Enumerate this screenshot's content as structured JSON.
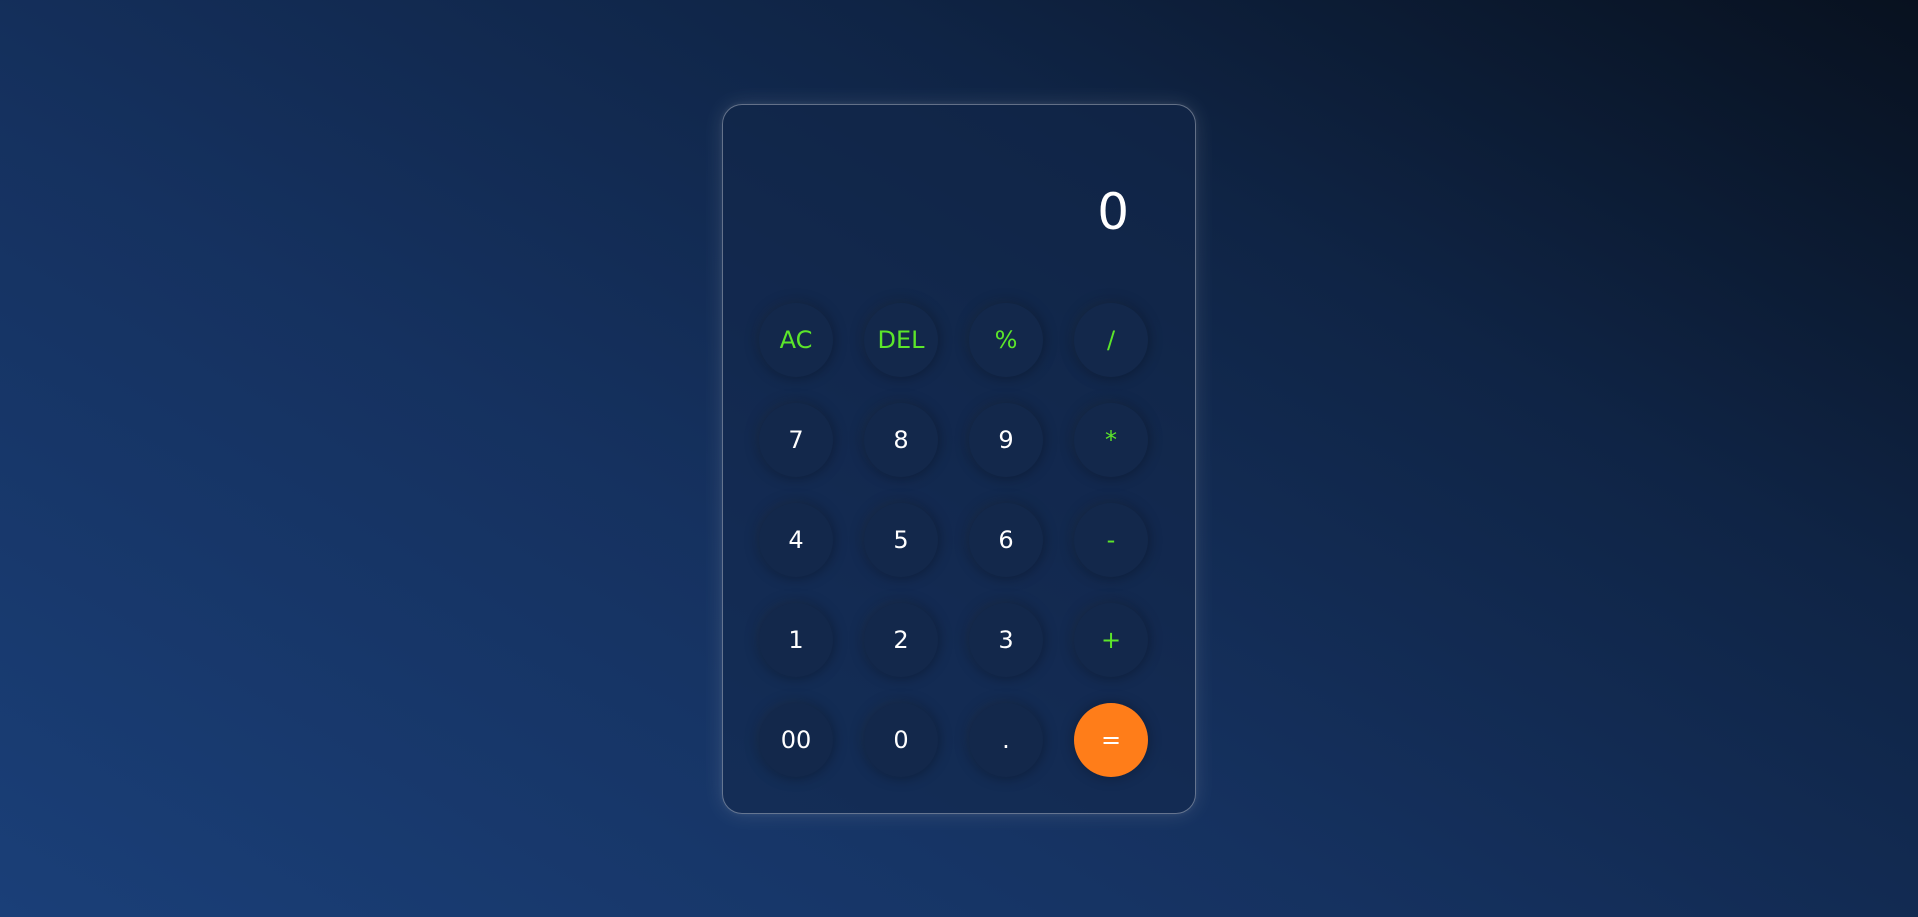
{
  "display": {
    "value": "0"
  },
  "keys": {
    "ac": "AC",
    "del": "DEL",
    "percent": "%",
    "divide": "/",
    "seven": "7",
    "eight": "8",
    "nine": "9",
    "multiply": "*",
    "four": "4",
    "five": "5",
    "six": "6",
    "minus": "-",
    "one": "1",
    "two": "2",
    "three": "3",
    "plus": "+",
    "double_zero": "00",
    "zero": "0",
    "dot": ".",
    "equals": "="
  },
  "colors": {
    "operator_text": "#5ce62a",
    "equals_background": "#ff7d19",
    "digit_text": "#ffffff",
    "key_background": "#13284b"
  }
}
